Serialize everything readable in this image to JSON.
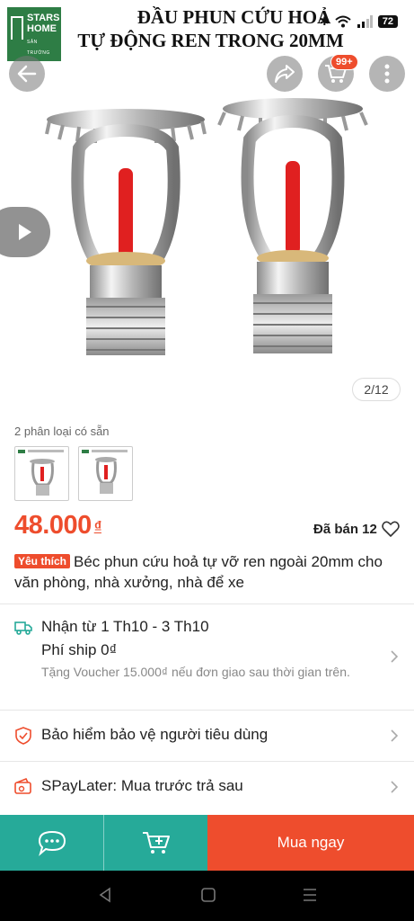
{
  "banner": {
    "line1": "ĐẦU PHUN CỨU HOẢ",
    "line2": "TỰ ĐỘNG REN TRONG 20MM",
    "logo_line1": "STARS",
    "logo_line2": "HOME",
    "logo_sub": "SÂN TRƯỜNG"
  },
  "status_bar": {
    "battery": "72"
  },
  "header": {
    "cart_badge": "99+"
  },
  "gallery": {
    "page_indicator": "2/12"
  },
  "variants": {
    "label": "2 phân loại có sẵn"
  },
  "product": {
    "price": "48.000",
    "currency": "₫",
    "sold": "Đã bán 12",
    "fav_tag": "Yêu thích",
    "title": "Béc phun cứu hoả tự vỡ ren ngoài 20mm cho văn phòng, nhà xưởng, nhà để xe"
  },
  "shipping": {
    "delivery": "Nhận từ 1 Th10 - 3 Th10",
    "fee": "Phí ship 0₫",
    "voucher": "Tặng Voucher 15.000₫ nếu đơn giao sau thời gian trên."
  },
  "protection": {
    "label": "Bảo hiểm bảo vệ người tiêu dùng"
  },
  "spaylater": {
    "label": "SPayLater: Mua trước trả sau"
  },
  "bottom_bar": {
    "buy_now": "Mua ngay"
  },
  "colors": {
    "accent": "#ee4d2d",
    "teal": "#26aa99",
    "logo_green": "#2e7d45"
  }
}
